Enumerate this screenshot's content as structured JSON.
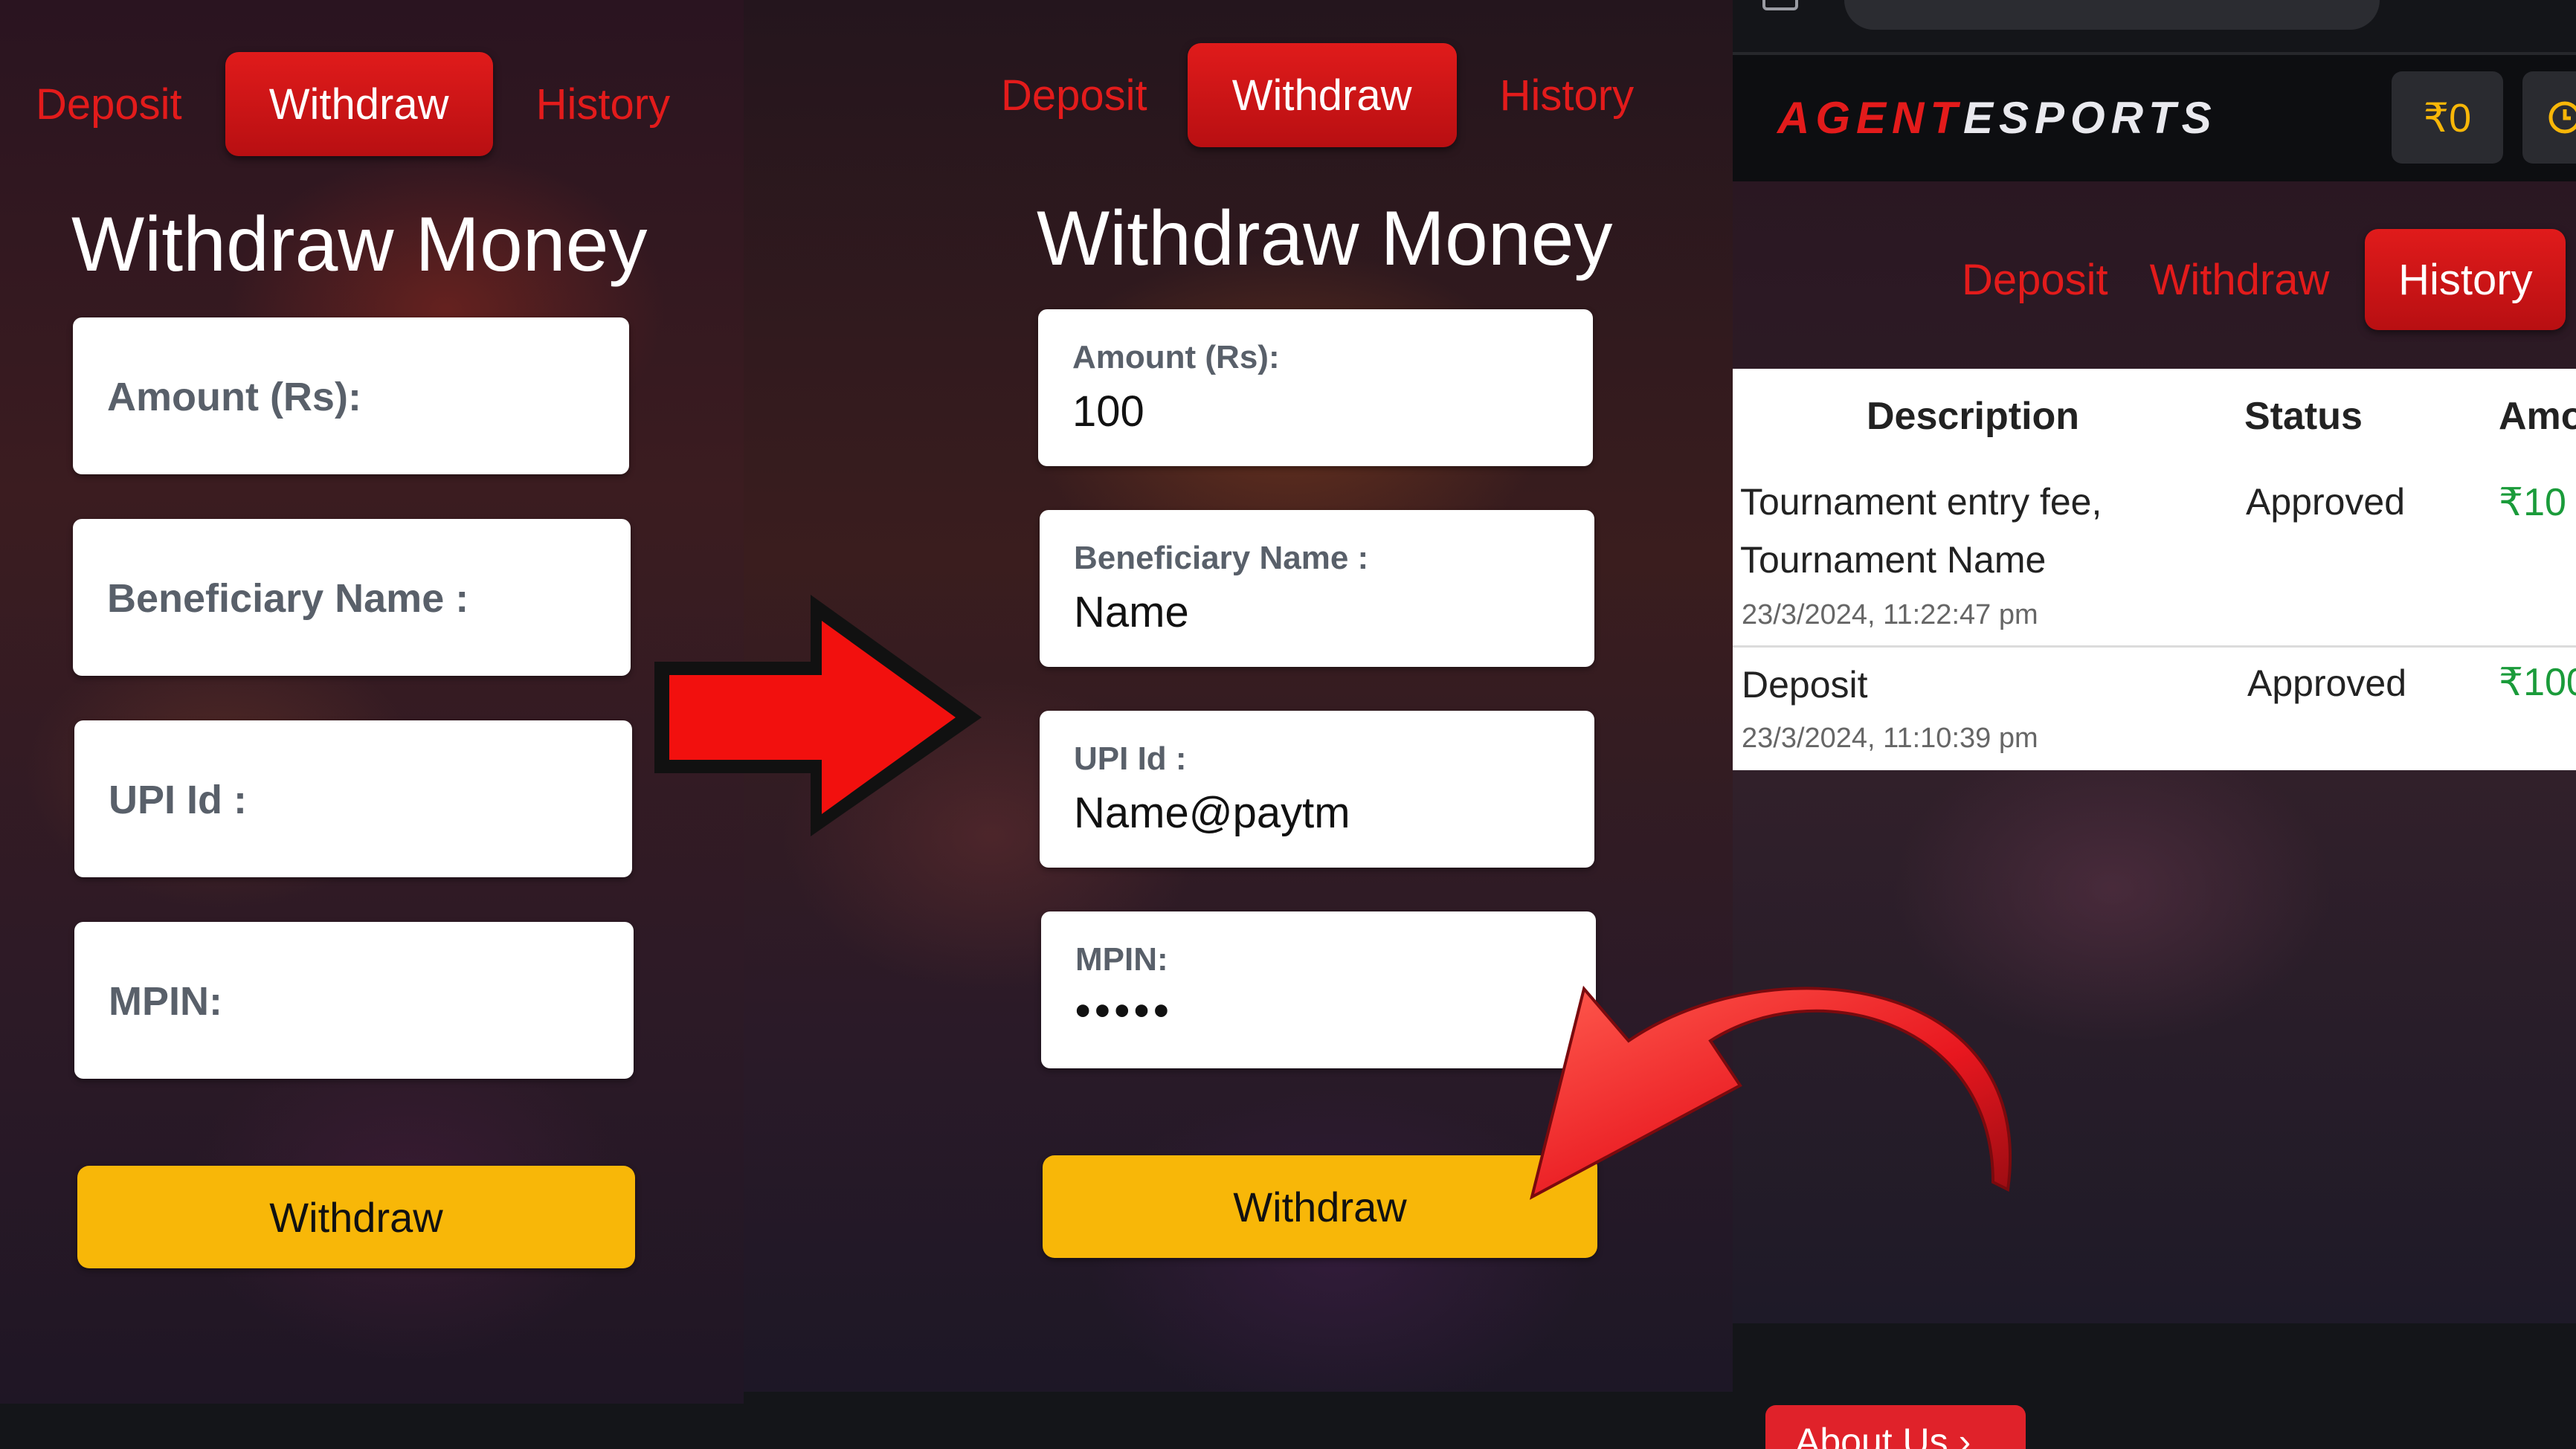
{
  "colors": {
    "accent_red": "#e31b1b",
    "button_yellow": "#f8b708",
    "approved_green": "#1a9b3a"
  },
  "panel1": {
    "tabs": {
      "deposit": "Deposit",
      "withdraw": "Withdraw",
      "history": "History"
    },
    "title": "Withdraw Money",
    "fields": {
      "amount_label": "Amount (Rs):",
      "beneficiary_label": "Beneficiary Name :",
      "upi_label": "UPI Id :",
      "mpin_label": "MPIN:"
    },
    "button": "Withdraw"
  },
  "panel2": {
    "tabs": {
      "deposit": "Deposit",
      "withdraw": "Withdraw",
      "history": "History"
    },
    "title": "Withdraw Money",
    "fields": {
      "amount_label": "Amount (Rs):",
      "amount_value": "100",
      "beneficiary_label": "Beneficiary Name :",
      "beneficiary_value": "Name",
      "upi_label": "UPI Id :",
      "upi_value": "Name@paytm",
      "mpin_label": "MPIN:",
      "mpin_value": "•••••"
    },
    "button": "Withdraw"
  },
  "panel3": {
    "brand": {
      "part1": "AGENT",
      "part2": "ESPORTS"
    },
    "balance": "₹0",
    "tabs": {
      "deposit": "Deposit",
      "withdraw": "Withdraw",
      "history": "History"
    },
    "table": {
      "headers": [
        "Description",
        "Status",
        "Amo"
      ],
      "rows": [
        {
          "description_line1": "Tournament entry fee,",
          "description_line2": "Tournament Name",
          "timestamp": "23/3/2024, 11:22:47 pm",
          "status": "Approved",
          "amount": "₹10"
        },
        {
          "description_line1": "Deposit",
          "timestamp": "23/3/2024, 11:10:39 pm",
          "status": "Approved",
          "amount": "₹100"
        }
      ]
    },
    "footer_button": "About Us"
  }
}
